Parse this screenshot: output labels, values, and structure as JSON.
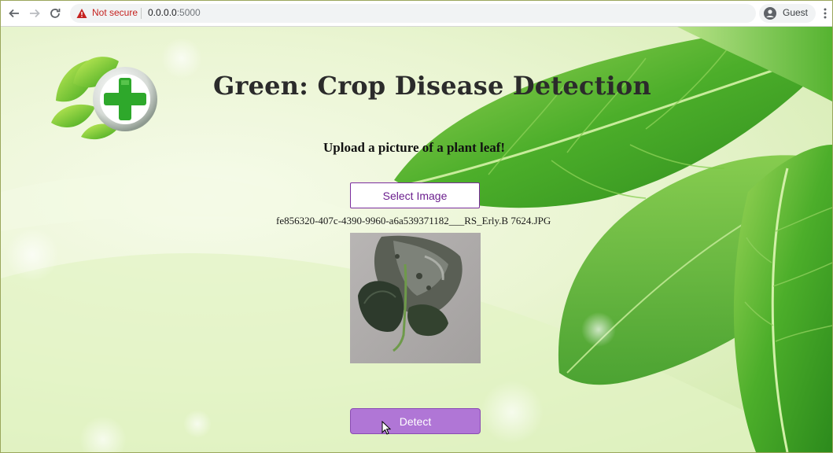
{
  "browser": {
    "security_label": "Not secure",
    "url_host": "0.0.0.0",
    "url_port": ":5000",
    "profile_label": "Guest",
    "icons": [
      "back-arrow-icon",
      "forward-arrow-icon",
      "reload-icon",
      "warning-icon",
      "profile-avatar-icon",
      "kebab-menu-icon"
    ]
  },
  "page": {
    "title": "Green: Crop Disease Detection",
    "subtitle": "Upload a picture of a plant leaf!",
    "select_label": "Select Image",
    "filename": "fe856320-407c-4390-9960-a6a539371182___RS_Erly.B 7624.JPG",
    "detect_label": "Detect",
    "logo_icon": "leaf-plus-logo-icon",
    "preview_icon": "diseased-leaf-image"
  },
  "colors": {
    "accent_purple": "#7b2c9e",
    "detect_button": "#b076d6",
    "leaf_green": "#4caf28",
    "warning_red": "#c5221f"
  }
}
